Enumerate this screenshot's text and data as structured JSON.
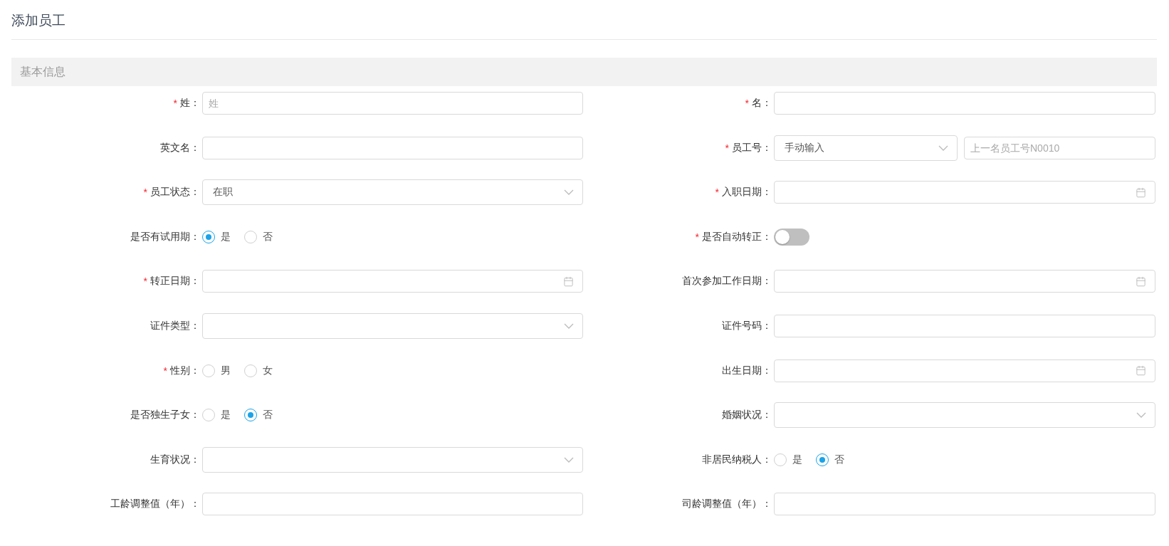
{
  "title": "添加员工",
  "section": {
    "title": "基本信息"
  },
  "fields": [
    {
      "label": "姓：",
      "required_mark": "*",
      "kind": "input",
      "placeholder": "姓"
    },
    {
      "label": "名：",
      "required_mark": "*",
      "kind": "input"
    },
    {
      "label": "英文名：",
      "kind": "input"
    },
    {
      "label": "员工号：",
      "required_mark": "*",
      "kind": "select_input",
      "value": "手动输入",
      "placeholder": "上一名员工号N0010"
    },
    {
      "label": "员工状态：",
      "required_mark": "*",
      "kind": "select",
      "value": "在职"
    },
    {
      "label": "入职日期：",
      "required_mark": "*",
      "kind": "date"
    },
    {
      "label": "是否有试用期：",
      "kind": "radio",
      "options": [
        {
          "label": "是",
          "selected": true
        },
        {
          "label": "否",
          "selected": false
        }
      ]
    },
    {
      "label": "是否自动转正：",
      "required_mark": "*",
      "kind": "switch",
      "on": false
    },
    {
      "label": "转正日期：",
      "required_mark": "*",
      "kind": "date"
    },
    {
      "label": "首次参加工作日期：",
      "kind": "date"
    },
    {
      "label": "证件类型：",
      "kind": "select"
    },
    {
      "label": "证件号码：",
      "kind": "input"
    },
    {
      "label": "性别：",
      "required_mark": "*",
      "kind": "radio",
      "options": [
        {
          "label": "男",
          "selected": false
        },
        {
          "label": "女",
          "selected": false
        }
      ]
    },
    {
      "label": "出生日期：",
      "kind": "date"
    },
    {
      "label": "是否独生子女：",
      "kind": "radio",
      "options": [
        {
          "label": "是",
          "selected": false
        },
        {
          "label": "否",
          "selected": true
        }
      ]
    },
    {
      "label": "婚姻状况：",
      "kind": "select"
    },
    {
      "label": "生育状况：",
      "kind": "select"
    },
    {
      "label": "非居民纳税人：",
      "kind": "radio",
      "options": [
        {
          "label": "是",
          "selected": false
        },
        {
          "label": "否",
          "selected": true
        }
      ]
    },
    {
      "label": "工龄调整值（年）：",
      "kind": "input"
    },
    {
      "label": "司龄调整值（年）：",
      "kind": "input"
    }
  ]
}
